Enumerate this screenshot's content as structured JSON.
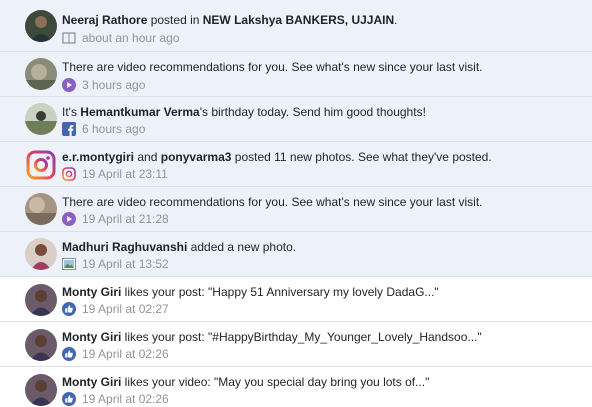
{
  "notifications": [
    {
      "status": "unread",
      "avatar": "person-photo",
      "actor": "Neeraj Rathore",
      "middle": " posted in ",
      "target": "NEW Lakshya BANKERS, UJJAIN",
      "after": ".",
      "time": "about an hour ago",
      "icon": "book-icon"
    },
    {
      "status": "unread",
      "avatar": "video-thumbnail",
      "actor": "",
      "middle": "There are video recommendations for you. See what's new since your last visit.",
      "target": "",
      "after": "",
      "time": "3 hours ago",
      "icon": "play-icon"
    },
    {
      "status": "unread",
      "avatar": "person-photo",
      "actor": "",
      "middle": "It's ",
      "target": "Hemantkumar Verma",
      "after": "'s birthday today. Send him good thoughts!",
      "time": "6 hours ago",
      "icon": "facebook-icon"
    },
    {
      "status": "unread",
      "avatar": "instagram-logo",
      "actor": "e.r.montygiri",
      "middle": " and ",
      "target": "ponyvarma3",
      "after": " posted 11 new photos. See what they've posted.",
      "time": "19 April at 23:11",
      "icon": "instagram-icon"
    },
    {
      "status": "unread",
      "avatar": "video-thumbnail",
      "actor": "",
      "middle": "There are video recommendations for you. See what's new since your last visit.",
      "target": "",
      "after": "",
      "time": "19 April at 21:28",
      "icon": "play-icon"
    },
    {
      "status": "unread",
      "avatar": "person-photo",
      "actor": "Madhuri Raghuvanshi",
      "middle": " added a new photo.",
      "target": "",
      "after": "",
      "time": "19 April at 13:52",
      "icon": "photo-icon"
    },
    {
      "status": "read",
      "avatar": "person-photo",
      "actor": "Monty Giri",
      "middle": " likes your post: \"Happy 51 Anniversary my lovely DadaG...\"",
      "target": "",
      "after": "",
      "time": "19 April at 02:27",
      "icon": "like-icon"
    },
    {
      "status": "read",
      "avatar": "person-photo",
      "actor": "Monty Giri",
      "middle": " likes your post: \"#HappyBirthday_My_Younger_Lovely_Handsoo...\"",
      "target": "",
      "after": "",
      "time": "19 April at 02:26",
      "icon": "like-icon"
    },
    {
      "status": "read",
      "avatar": "person-photo",
      "actor": "Monty Giri",
      "middle": " likes your video: \"May you special day bring you lots of...\"",
      "target": "",
      "after": "",
      "time": "19 April at 02:26",
      "icon": "like-icon"
    }
  ],
  "colors": {
    "unread_bg": "#edf2fa",
    "read_bg": "#ffffff",
    "divider": "#dddfe2",
    "text": "#1d2129",
    "meta": "#90949c",
    "facebook_blue": "#4267b2",
    "play_purple": "#8b5fc4"
  }
}
